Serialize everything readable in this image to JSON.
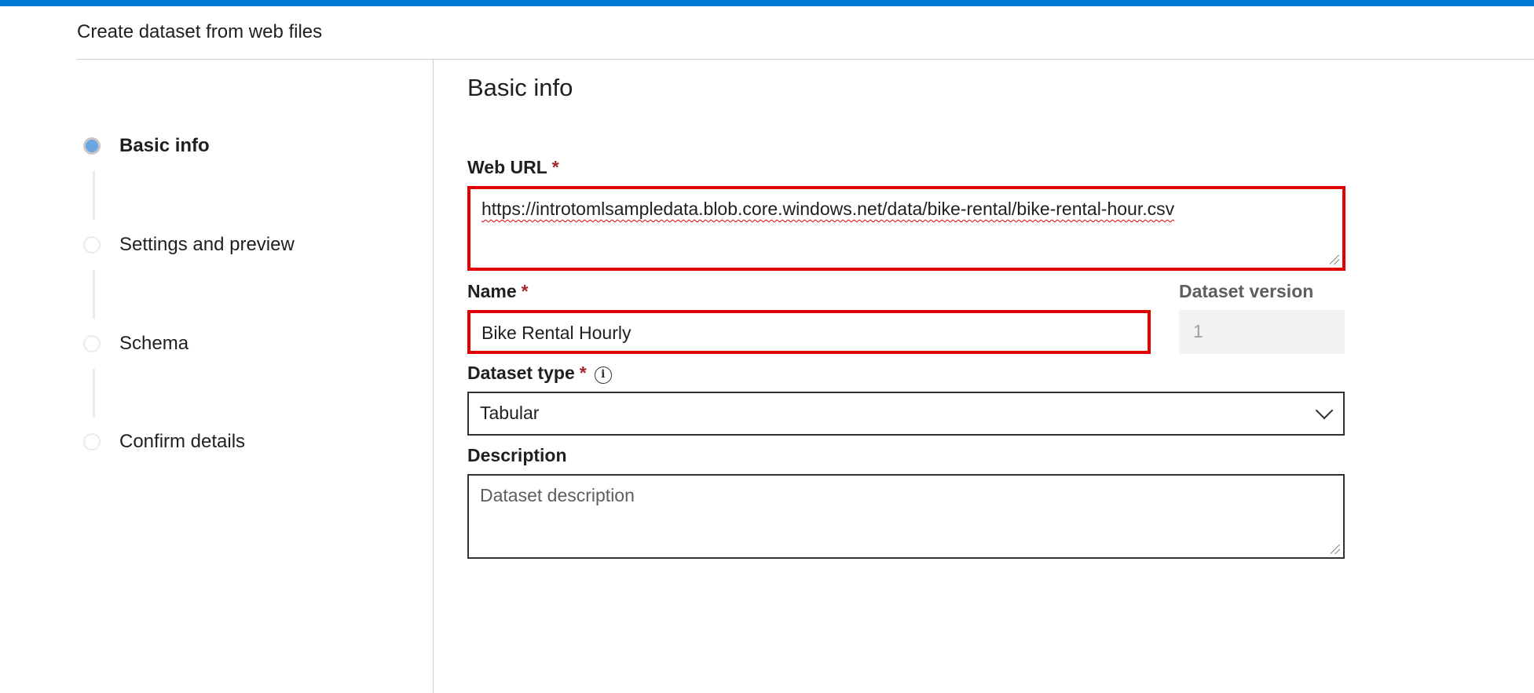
{
  "panel": {
    "title": "Create dataset from web files"
  },
  "stepper": {
    "steps": [
      {
        "label": "Basic info",
        "state": "active"
      },
      {
        "label": "Settings and preview",
        "state": "pending"
      },
      {
        "label": "Schema",
        "state": "pending"
      },
      {
        "label": "Confirm details",
        "state": "pending"
      }
    ]
  },
  "form": {
    "section_title": "Basic info",
    "web_url": {
      "label": "Web URL",
      "required_mark": "*",
      "value": "https://introtomlsampledata.blob.core.windows.net/data/bike-rental/bike-rental-hour.csv"
    },
    "name": {
      "label": "Name",
      "required_mark": "*",
      "value": "Bike Rental Hourly"
    },
    "dataset_version": {
      "label": "Dataset version",
      "value": "1"
    },
    "dataset_type": {
      "label": "Dataset type",
      "required_mark": "*",
      "info_icon": "info-icon",
      "selected": "Tabular"
    },
    "description": {
      "label": "Description",
      "placeholder": "Dataset description",
      "value": ""
    }
  },
  "colors": {
    "accent": "#0078d4",
    "highlight_border": "#e00000",
    "required": "#a4262c",
    "active_step": "#6ca6e2"
  }
}
